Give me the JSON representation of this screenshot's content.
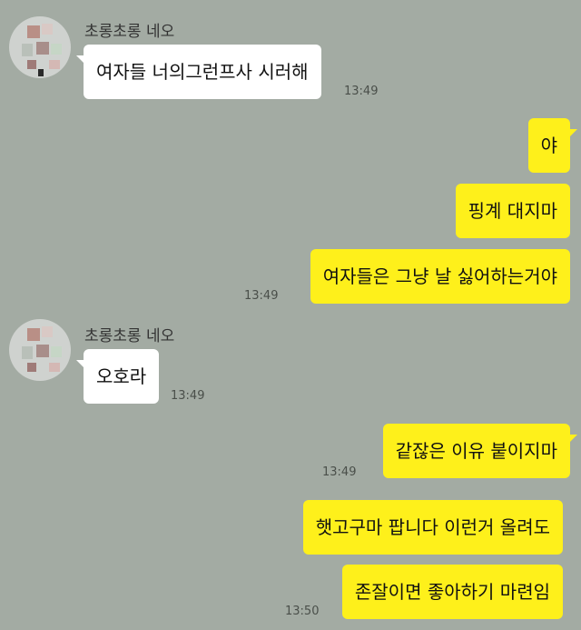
{
  "chat": {
    "sender_name": "초롱초롱 네오",
    "messages": [
      {
        "text": "여자들 너의그런프사 시러해",
        "time": "13:49"
      },
      {
        "text": "야"
      },
      {
        "text": "핑계 대지마"
      },
      {
        "text": "여자들은 그냥 날 싫어하는거야",
        "time": "13:49"
      },
      {
        "text": "오호라",
        "time": "13:49"
      },
      {
        "text": "같잖은 이유 붙이지마",
        "time": "13:49"
      },
      {
        "text": "햇고구마 팝니다 이런거 올려도"
      },
      {
        "text": "존잘이면 좋아하기 마련임",
        "time": "13:50"
      }
    ]
  },
  "colors": {
    "background": "#a3aba3",
    "my_bubble": "#fef01b",
    "their_bubble": "#ffffff"
  }
}
